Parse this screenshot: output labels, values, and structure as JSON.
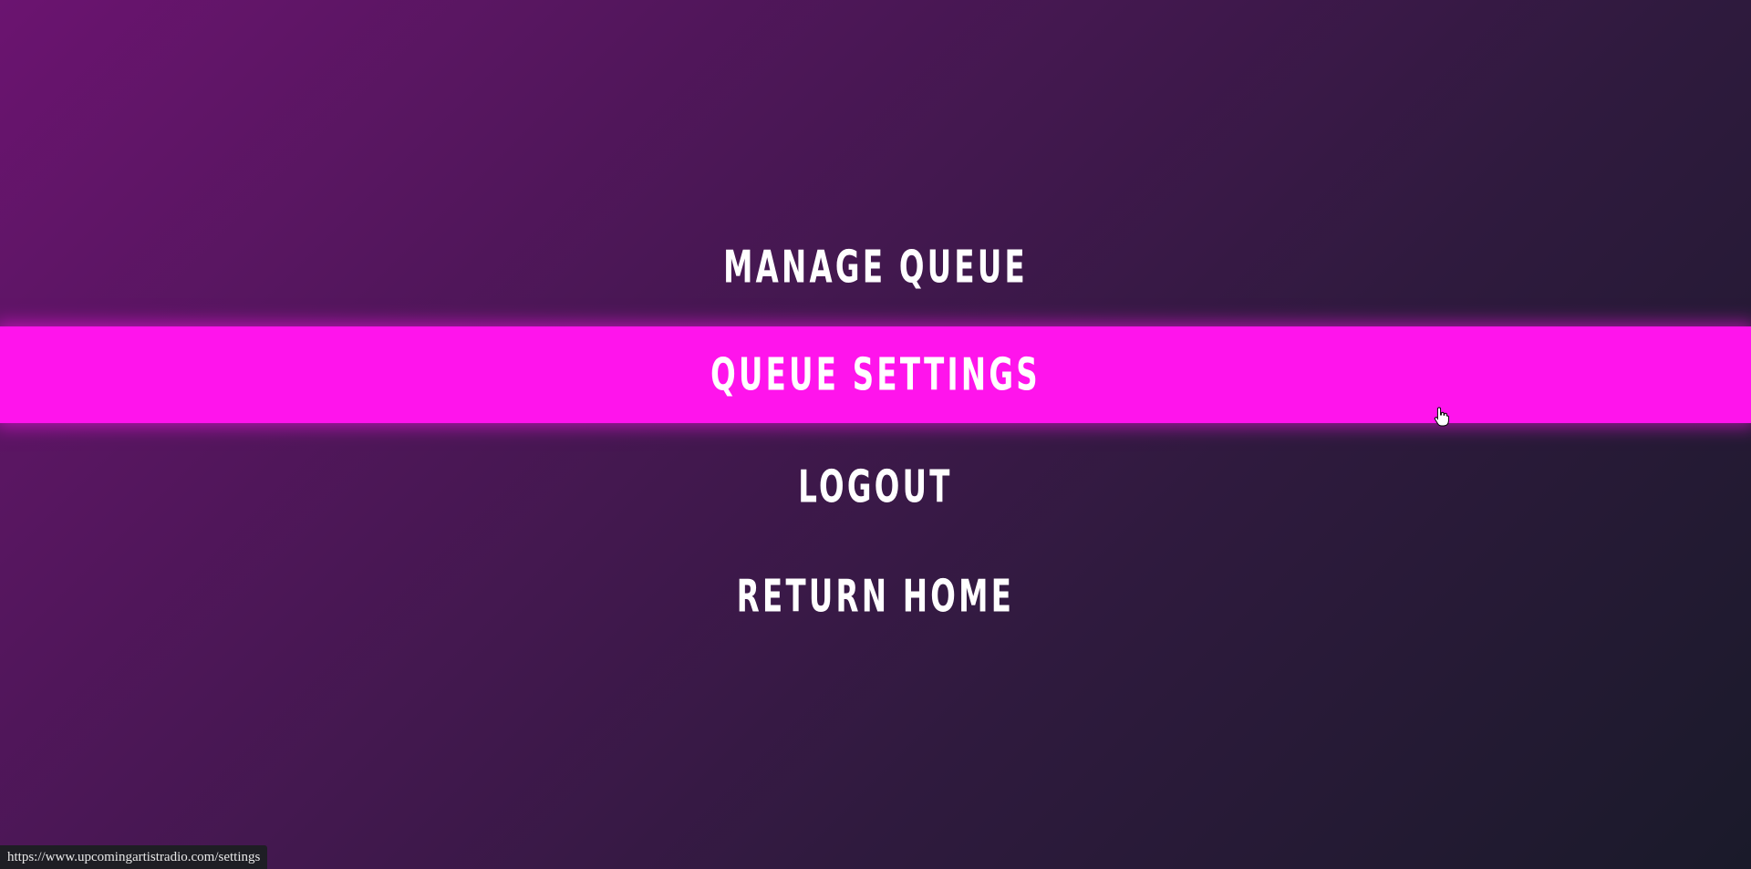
{
  "menu": {
    "items": [
      {
        "label": "MANAGE QUEUE"
      },
      {
        "label": "QUEUE SETTINGS",
        "active": true
      },
      {
        "label": "LOGOUT"
      },
      {
        "label": "RETURN HOME"
      }
    ]
  },
  "status_bar": {
    "url": "https://www.upcomingartistradio.com/settings"
  },
  "colors": {
    "highlight": "#ff14ec",
    "text": "#ffffff",
    "background_start": "#6b1470",
    "background_end": "#1a1a2a"
  },
  "icons": {
    "cursor": "hand-pointer-icon"
  }
}
